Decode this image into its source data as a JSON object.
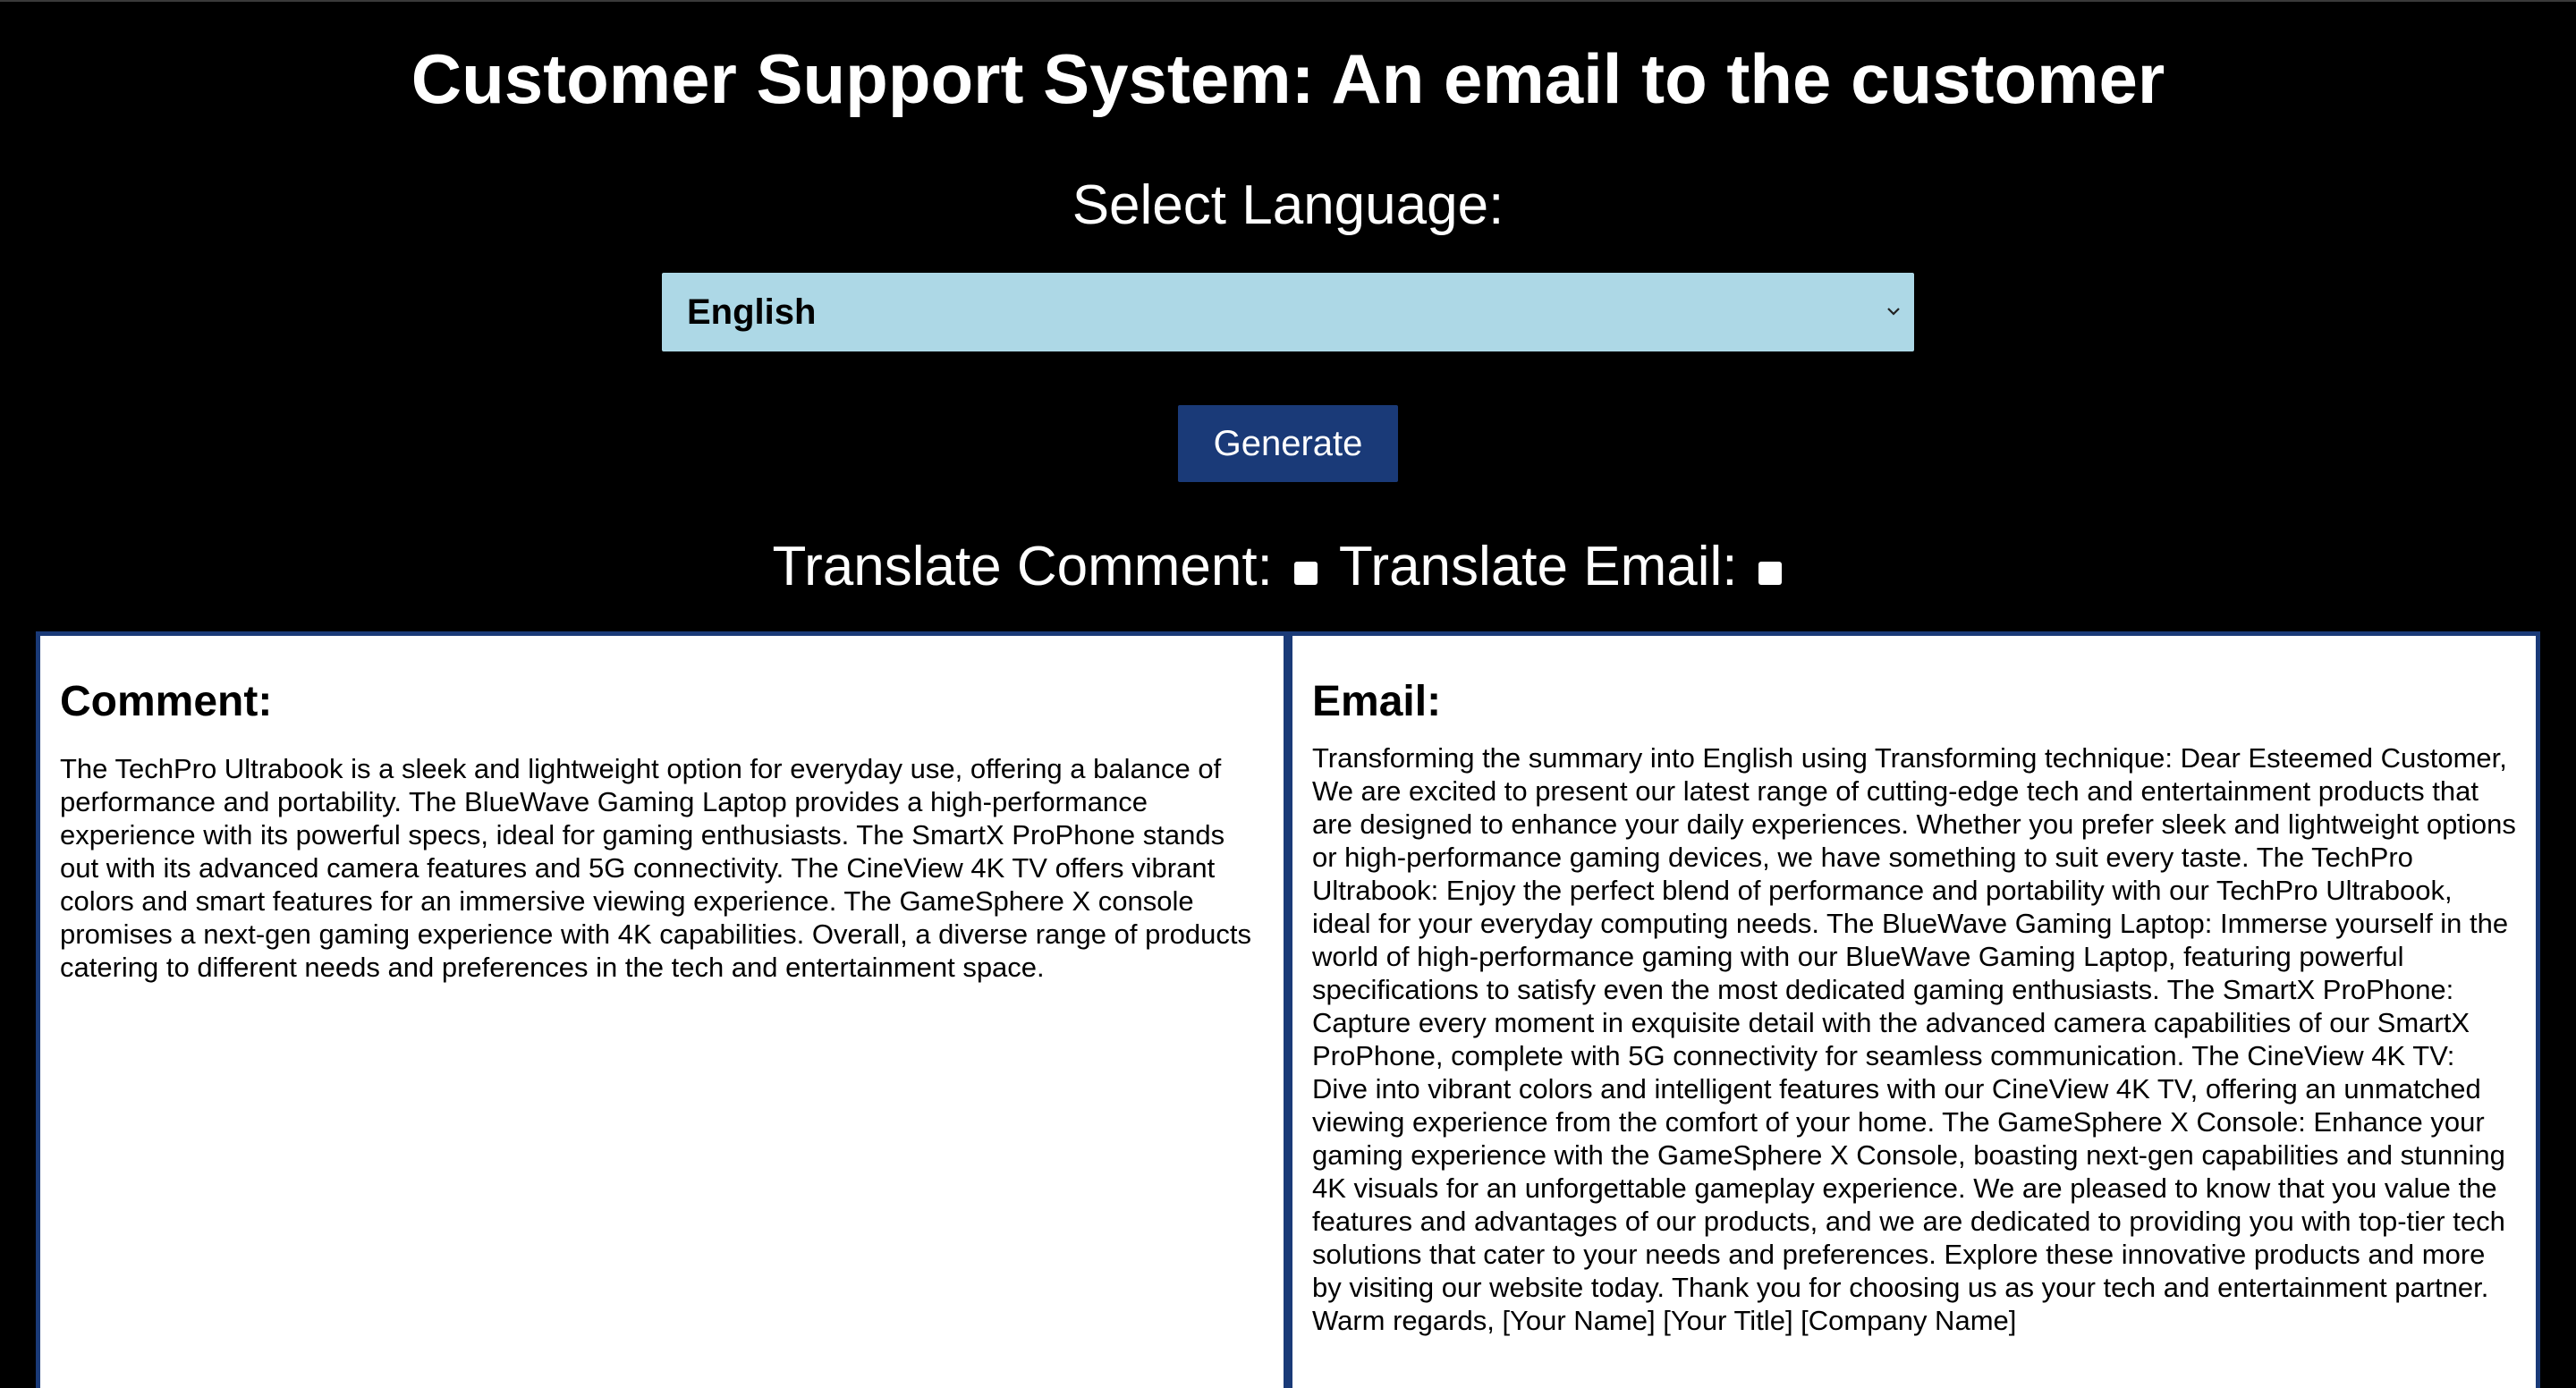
{
  "page": {
    "title": "Customer Support System: An email to the customer"
  },
  "language": {
    "label": "Select Language:",
    "selected": "English"
  },
  "actions": {
    "generate_label": "Generate"
  },
  "translate": {
    "comment_label": "Translate Comment:",
    "email_label": "Translate Email:",
    "comment_checked": false,
    "email_checked": false
  },
  "comment": {
    "heading": "Comment:",
    "body": "The TechPro Ultrabook is a sleek and lightweight option for everyday use, offering a balance of performance and portability. The BlueWave Gaming Laptop provides a high-performance experience with its powerful specs, ideal for gaming enthusiasts. The SmartX ProPhone stands out with its advanced camera features and 5G connectivity. The CineView 4K TV offers vibrant colors and smart features for an immersive viewing experience. The GameSphere X console promises a next-gen gaming experience with 4K capabilities. Overall, a diverse range of products catering to different needs and preferences in the tech and entertainment space."
  },
  "email": {
    "heading": "Email:",
    "body": "Transforming the summary into English using Transforming technique: Dear Esteemed Customer, We are excited to present our latest range of cutting-edge tech and entertainment products that are designed to enhance your daily experiences. Whether you prefer sleek and lightweight options or high-performance gaming devices, we have something to suit every taste. The TechPro Ultrabook: Enjoy the perfect blend of performance and portability with our TechPro Ultrabook, ideal for your everyday computing needs. The BlueWave Gaming Laptop: Immerse yourself in the world of high-performance gaming with our BlueWave Gaming Laptop, featuring powerful specifications to satisfy even the most dedicated gaming enthusiasts. The SmartX ProPhone: Capture every moment in exquisite detail with the advanced camera capabilities of our SmartX ProPhone, complete with 5G connectivity for seamless communication. The CineView 4K TV: Dive into vibrant colors and intelligent features with our CineView 4K TV, offering an unmatched viewing experience from the comfort of your home. The GameSphere X Console: Enhance your gaming experience with the GameSphere X Console, boasting next-gen capabilities and stunning 4K visuals for an unforgettable gameplay experience. We are pleased to know that you value the features and advantages of our products, and we are dedicated to providing you with top-tier tech solutions that cater to your needs and preferences. Explore these innovative products and more by visiting our website today. Thank you for choosing us as your tech and entertainment partner. Warm regards, [Your Name] [Your Title] [Company Name]"
  },
  "colors": {
    "background": "#000000",
    "select_bg": "#add8e6",
    "button_bg": "#1a3a78",
    "panel_border": "#1a3a78"
  },
  "icons": {
    "select_chevron": "chevron-down-icon"
  }
}
